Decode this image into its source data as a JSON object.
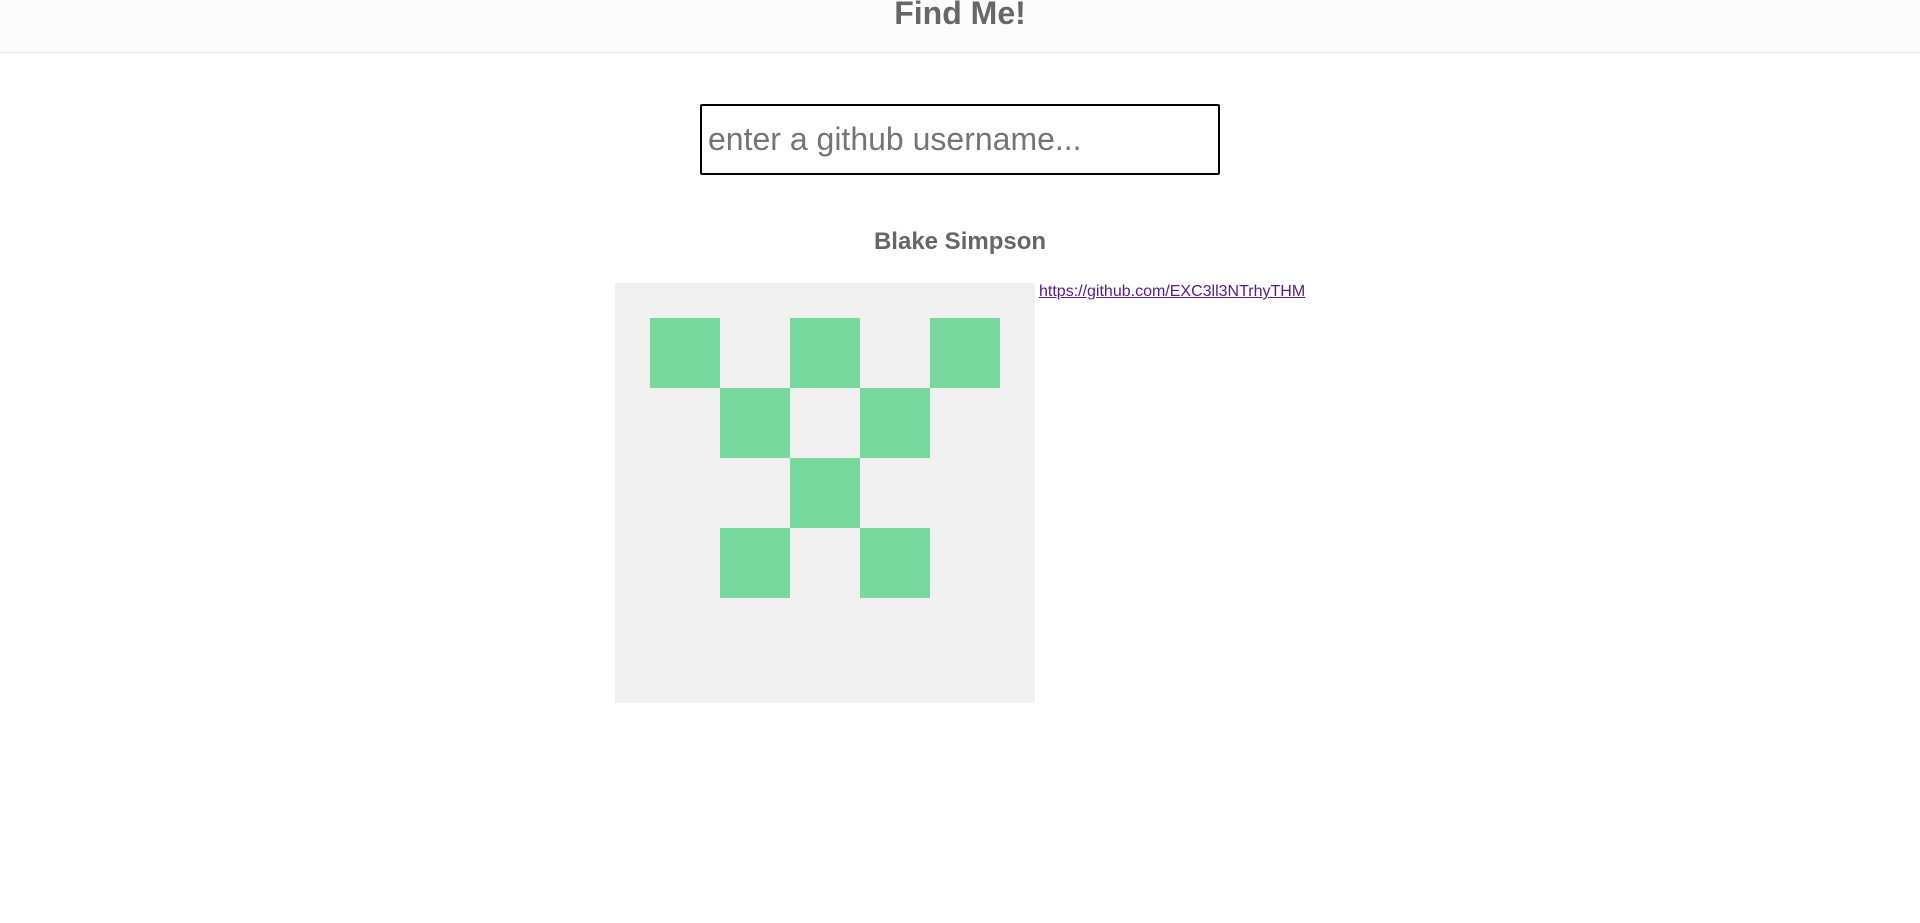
{
  "header": {
    "title": "Find Me!"
  },
  "search": {
    "placeholder": "enter a github username...",
    "value": ""
  },
  "profile": {
    "name": "Blake Simpson",
    "url": "https://github.com/EXC3ll3NTrhyTHM",
    "avatar": {
      "background_color": "#f0f0f0",
      "cell_color": "#77d89d",
      "grid": [
        [
          1,
          0,
          1,
          0,
          1
        ],
        [
          0,
          1,
          0,
          1,
          0
        ],
        [
          0,
          0,
          1,
          0,
          0
        ],
        [
          0,
          1,
          0,
          1,
          0
        ],
        [
          0,
          0,
          0,
          0,
          0
        ]
      ]
    }
  },
  "colors": {
    "link_visited": "#551a8b",
    "heading_text": "#666666"
  }
}
